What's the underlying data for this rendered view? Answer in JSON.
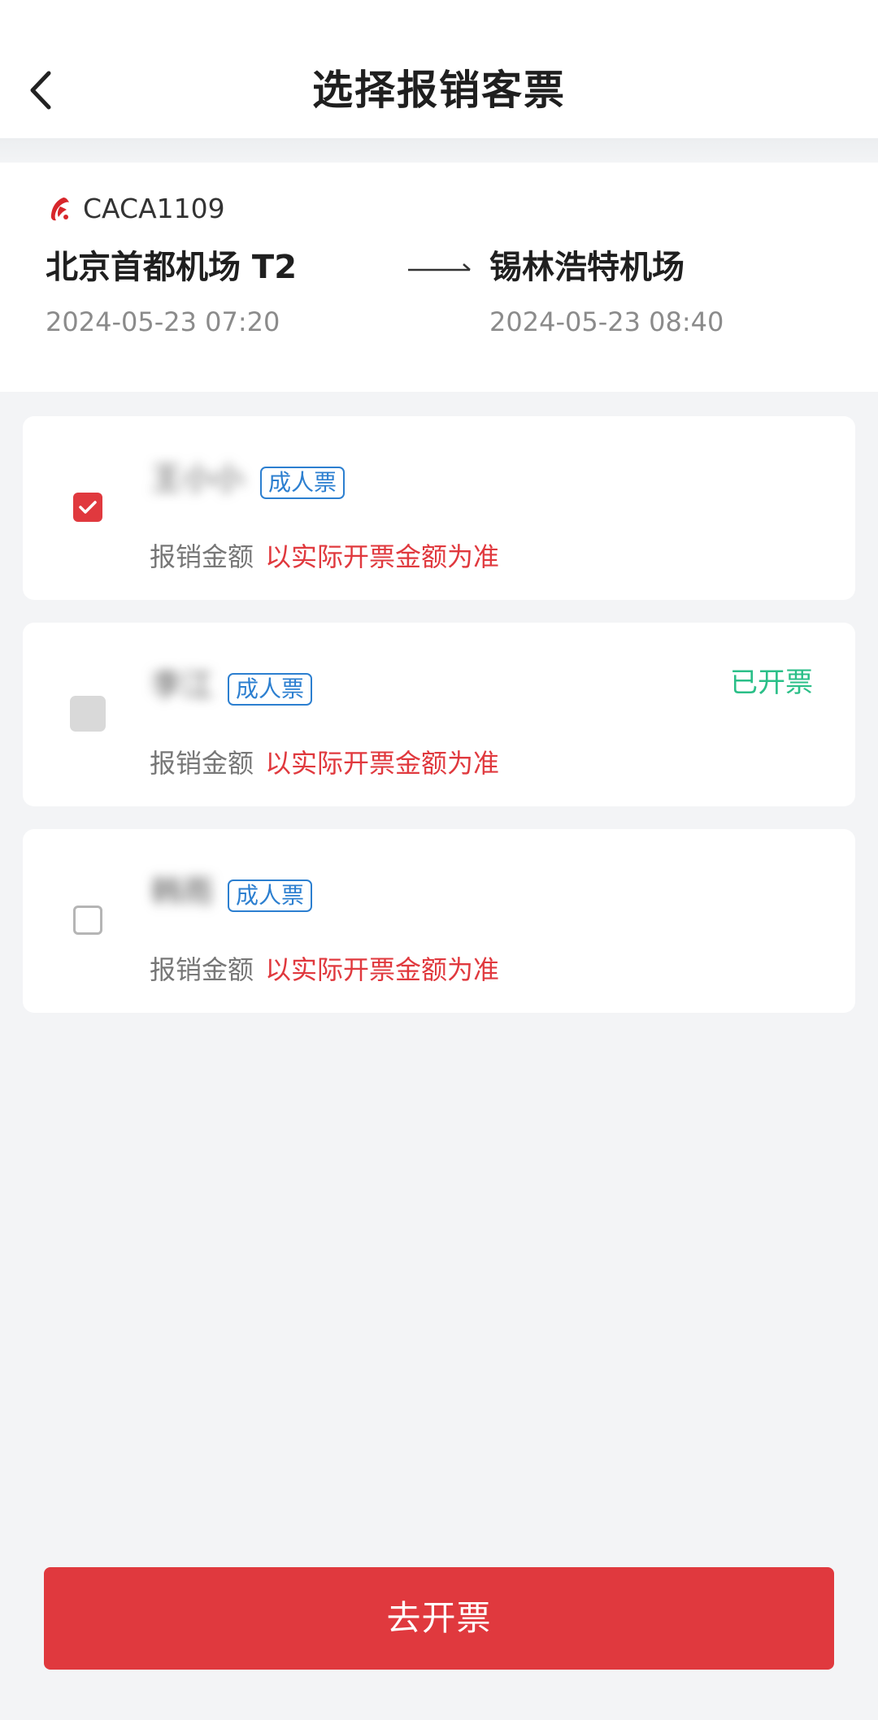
{
  "header": {
    "title": "选择报销客票",
    "back_icon": "chevron-left-icon"
  },
  "flight": {
    "airline_icon": "air-china-logo",
    "flight_number": "CACA1109",
    "departure_airport": "北京首都机场 T2",
    "arrival_airport": "锡林浩特机场",
    "departure_time": "2024-05-23 07:20",
    "arrival_time": "2024-05-23 08:40"
  },
  "passengers": [
    {
      "name": "王小小",
      "ticket_type": "成人票",
      "checkbox_state": "checked",
      "status": "",
      "amount_label": "报销金额",
      "amount_value": "以实际开票金额为准"
    },
    {
      "name": "李江",
      "ticket_type": "成人票",
      "checkbox_state": "disabled",
      "status": "已开票",
      "amount_label": "报销金额",
      "amount_value": "以实际开票金额为准"
    },
    {
      "name": "韩雨",
      "ticket_type": "成人票",
      "checkbox_state": "unchecked",
      "status": "",
      "amount_label": "报销金额",
      "amount_value": "以实际开票金额为准"
    }
  ],
  "footer": {
    "button_label": "去开票"
  },
  "colors": {
    "accent_red": "#e0393e",
    "badge_blue": "#2c7fd0",
    "issued_green": "#2bbf88"
  }
}
